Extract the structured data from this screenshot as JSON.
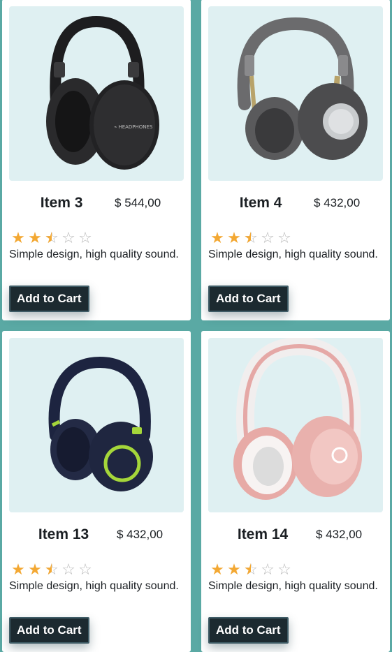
{
  "products": [
    {
      "name": "Item 3",
      "price": "$ 544,00",
      "rating": 2.5,
      "description": "Simple design, high quality sound.",
      "cart_label": "Add to Cart",
      "image": "black-headphones"
    },
    {
      "name": "Item 4",
      "price": "$ 432,00",
      "rating": 2.5,
      "description": "Simple design, high quality sound.",
      "cart_label": "Add to Cart",
      "image": "gray-gold-headphones"
    },
    {
      "name": "Item 13",
      "price": "$ 432,00",
      "rating": 2.5,
      "description": "Simple design, high quality sound.",
      "cart_label": "Add to Cart",
      "image": "navy-lime-headphones"
    },
    {
      "name": "Item 14",
      "price": "$ 432,00",
      "rating": 2.5,
      "description": "Simple design, high quality sound.",
      "cart_label": "Add to Cart",
      "image": "pink-white-headphones"
    }
  ],
  "colors": {
    "page_background": "#5aa9a4",
    "card_background": "#ffffff",
    "image_background": "#dff0f2",
    "star_filled": "#f3a833",
    "star_empty": "#b9b9b9",
    "button_background": "#1c2a30",
    "button_text": "#ffffff"
  },
  "icons": {
    "star_filled": "star-filled-icon",
    "star_half": "star-half-icon",
    "star_empty": "star-empty-icon"
  }
}
